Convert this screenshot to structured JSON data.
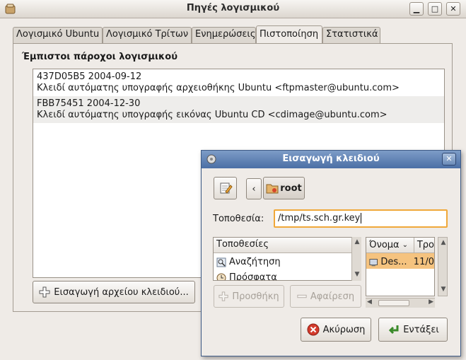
{
  "window": {
    "title": "Πηγές λογισμικού"
  },
  "tabs": [
    {
      "label": "Λογισμικό Ubuntu"
    },
    {
      "label": "Λογισμικό Τρίτων"
    },
    {
      "label": "Ενημερώσεις"
    },
    {
      "label": "Πιστοποίηση"
    },
    {
      "label": "Στατιστικά"
    }
  ],
  "authentication": {
    "heading": "Έμπιστοι πάροχοι λογισμικού",
    "keys": [
      {
        "id_date": "437D05B5 2004-09-12",
        "description": "Κλειδί αυτόματης υπογραφής αρχειοθήκης Ubuntu <ftpmaster@ubuntu.com>"
      },
      {
        "id_date": "FBB75451 2004-12-30",
        "description": "Κλειδί αυτόματης υπογραφής εικόνας Ubuntu CD <cdimage@ubuntu.com>"
      }
    ],
    "import_button": "Εισαγωγή αρχείου κλειδιού..."
  },
  "dialog": {
    "title": "Εισαγωγή κλειδιού",
    "path_button": "root",
    "location_label": "Τοποθεσία:",
    "location_value": "/tmp/ts.sch.gr.key",
    "places_header": "Τοποθεσίες",
    "places": [
      {
        "label": "Αναζήτηση",
        "icon": "search-icon"
      },
      {
        "label": "Πρόσφατα",
        "icon": "recent-icon"
      }
    ],
    "add_button": "Προσθήκη",
    "remove_button": "Αφαίρεση",
    "files_header_name": "Όνομα",
    "files_header_modified": "Τρο",
    "files": [
      {
        "name": "Des...",
        "modified": "11/0"
      }
    ],
    "cancel_button": "Ακύρωση",
    "ok_button": "Εντάξει"
  },
  "colors": {
    "accent": "#f0a83a",
    "dialog_title": "#4b6fa5",
    "selection": "#f5c37f"
  }
}
